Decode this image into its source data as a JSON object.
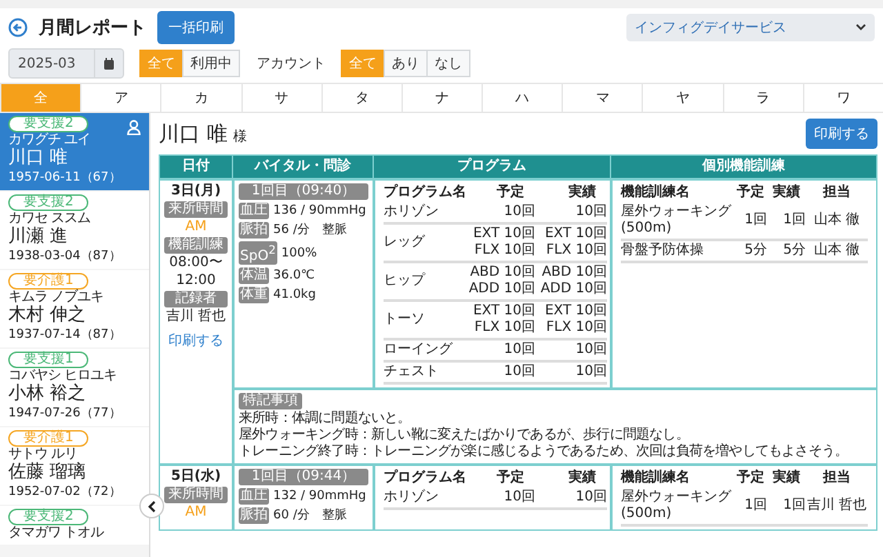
{
  "header": {
    "title": "月間レポート",
    "bulk_print": "一括印刷",
    "facility": "インフィグデイサービス"
  },
  "filters": {
    "month": "2025-03",
    "usage": [
      {
        "label": "全て",
        "selected": true
      },
      {
        "label": "利用中",
        "selected": false
      }
    ],
    "account_label": "アカウント",
    "account": [
      {
        "label": "全て",
        "selected": true
      },
      {
        "label": "あり",
        "selected": false
      },
      {
        "label": "なし",
        "selected": false
      }
    ]
  },
  "kana_tabs": [
    {
      "label": "全",
      "selected": true
    },
    {
      "label": "ア",
      "selected": false
    },
    {
      "label": "カ",
      "selected": false
    },
    {
      "label": "サ",
      "selected": false
    },
    {
      "label": "タ",
      "selected": false
    },
    {
      "label": "ナ",
      "selected": false
    },
    {
      "label": "ハ",
      "selected": false
    },
    {
      "label": "マ",
      "selected": false
    },
    {
      "label": "ヤ",
      "selected": false
    },
    {
      "label": "ラ",
      "selected": false
    },
    {
      "label": "ワ",
      "selected": false
    }
  ],
  "patients": [
    {
      "care_level": "要支援2",
      "color": "#4cb878",
      "kana": "カワグチ ユイ",
      "name": "川口 唯",
      "birth": "1957-06-11（67）",
      "selected": true
    },
    {
      "care_level": "要支援2",
      "color": "#4cb878",
      "kana": "カワセ ススム",
      "name": "川瀬 進",
      "birth": "1938-03-04（87）",
      "selected": false
    },
    {
      "care_level": "要介護1",
      "color": "#f5a623",
      "kana": "キムラ ノブユキ",
      "name": "木村 伸之",
      "birth": "1937-07-14（87）",
      "selected": false
    },
    {
      "care_level": "要支援1",
      "color": "#4cb878",
      "kana": "コバヤシ ヒロユキ",
      "name": "小林 裕之",
      "birth": "1947-07-26（77）",
      "selected": false
    },
    {
      "care_level": "要介護1",
      "color": "#f5a623",
      "kana": "サトウ ルリ",
      "name": "佐藤 瑠璃",
      "birth": "1952-07-02（72）",
      "selected": false
    },
    {
      "care_level": "要支援2",
      "color": "#4cb878",
      "kana": "タマガワ トオル",
      "selected": false
    }
  ],
  "report": {
    "patient_name": "川口 唯",
    "honorific": "様",
    "print": "印刷する",
    "columns": [
      "日付",
      "バイタル・問診",
      "プログラム",
      "個別機能訓練"
    ],
    "days": [
      {
        "date": "3日(月)",
        "arrival_label": "来所時間",
        "arrival": "AM",
        "training_label": "機能訓練",
        "training_time": [
          "08:00〜",
          "12:00"
        ],
        "recorder_label": "記録者",
        "recorder": "吉川 哲也",
        "print_link": "印刷する",
        "vitals": {
          "session": "1回目（09:40）",
          "items": [
            {
              "label": "血圧",
              "value": "136 / 90mmHg"
            },
            {
              "label": "脈拍",
              "value": "56 /分　整脈"
            },
            {
              "label": "SpO$^{2}$",
              "value": "100%"
            },
            {
              "label": "体温",
              "value": "36.0℃"
            },
            {
              "label": "体重",
              "value": "41.0kg"
            }
          ]
        },
        "program": {
          "columns": [
            "プログラム名",
            "予定",
            "実績"
          ],
          "rows": [
            {
              "name": "ホリゾン",
              "plan": [
                "10回"
              ],
              "actual": [
                "10回"
              ]
            },
            {
              "name": "レッグ",
              "plan": [
                "EXT 10回",
                "FLX 10回"
              ],
              "actual": [
                "EXT 10回",
                "FLX 10回"
              ]
            },
            {
              "name": "ヒップ",
              "plan": [
                "ABD 10回",
                "ADD 10回"
              ],
              "actual": [
                "ABD 10回",
                "ADD 10回"
              ]
            },
            {
              "name": "トーソ",
              "plan": [
                "EXT 10回",
                "FLX 10回"
              ],
              "actual": [
                "EXT 10回",
                "FLX 10回"
              ]
            },
            {
              "name": "ローイング",
              "plan": [
                "10回"
              ],
              "actual": [
                "10回"
              ]
            },
            {
              "name": "チェスト",
              "plan": [
                "10回"
              ],
              "actual": [
                "10回"
              ]
            }
          ]
        },
        "training": {
          "columns": [
            "機能訓練名",
            "予定",
            "実績",
            "担当"
          ],
          "rows": [
            {
              "name": "屋外ウォーキング(500m)",
              "plan": "1回",
              "actual": "1回",
              "staff": "山本 徹"
            },
            {
              "name": "骨盤予防体操",
              "plan": "5分",
              "actual": "5分",
              "staff": "山本 徹"
            }
          ]
        },
        "notes": {
          "label": "特記事項",
          "lines": [
            "来所時：体調に問題ないと。",
            "屋外ウォーキング時：新しい靴に変えたばかりであるが、歩行に問題なし。",
            "トレーニング終了時：トレーニングが楽に感じるようであるため、次回は負荷を増やしてもよさそう。"
          ]
        }
      },
      {
        "date": "5日(水)",
        "arrival_label": "来所時間",
        "arrival": "AM",
        "vitals": {
          "session": "1回目（09:44）",
          "items": [
            {
              "label": "血圧",
              "value": "132 / 90mmHg"
            },
            {
              "label": "脈拍",
              "value": "60 /分　整脈"
            }
          ]
        },
        "program": {
          "columns": [
            "プログラム名",
            "予定",
            "実績"
          ],
          "rows": [
            {
              "name": "ホリゾン",
              "plan": [
                "10回"
              ],
              "actual": [
                "10回"
              ]
            }
          ]
        },
        "training": {
          "columns": [
            "機能訓練名",
            "予定",
            "実績",
            "担当"
          ],
          "rows": [
            {
              "name": "屋外ウォーキング(500m)",
              "plan": "1回",
              "actual": "1回",
              "staff": "吉川 哲也"
            }
          ]
        }
      }
    ]
  }
}
